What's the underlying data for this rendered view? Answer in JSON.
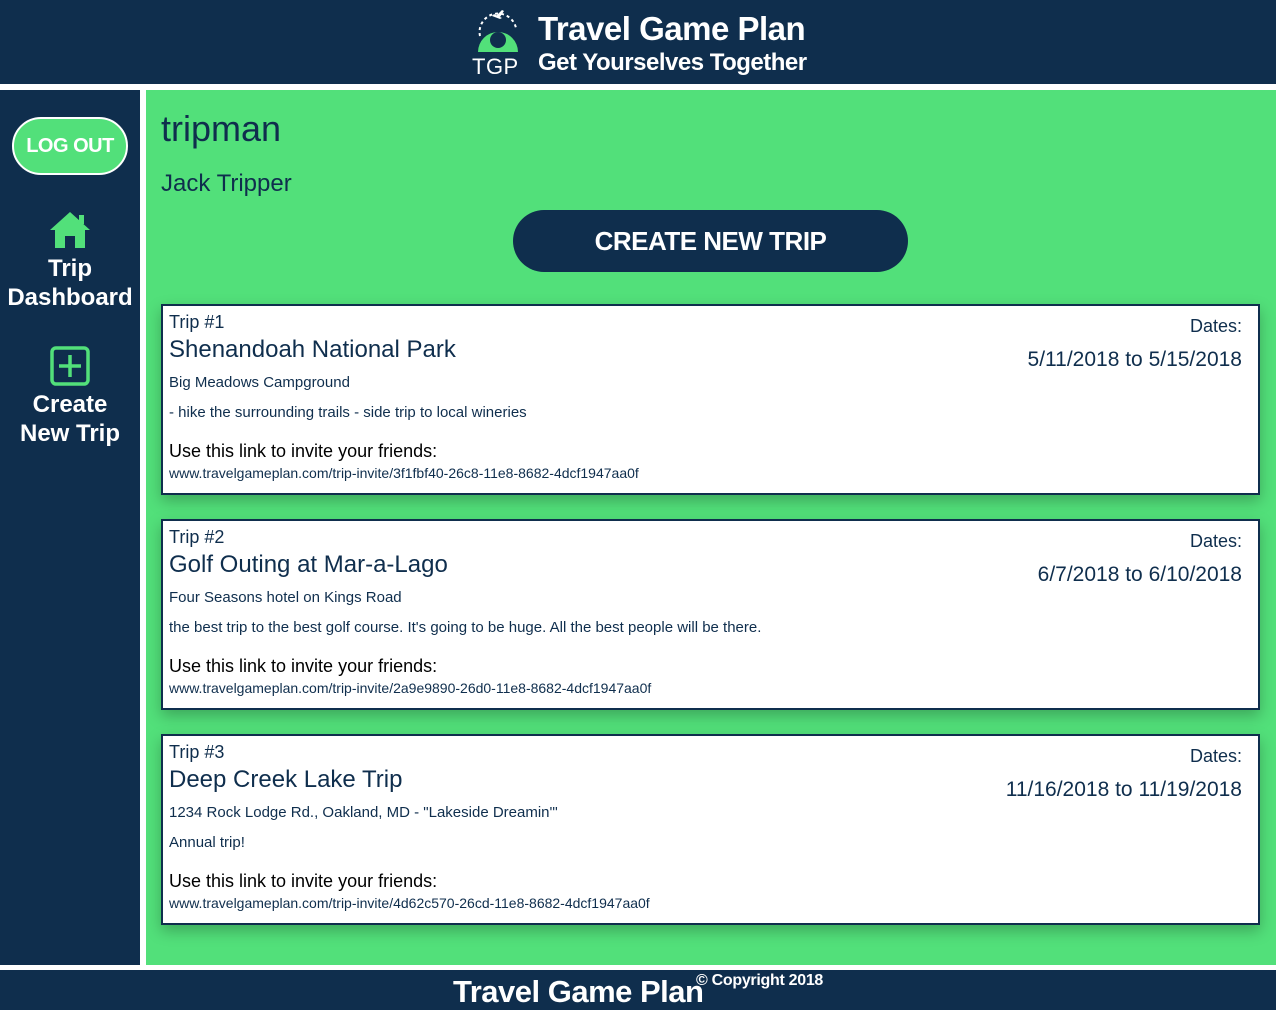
{
  "header": {
    "logo_text": "TGP",
    "title": "Travel Game Plan",
    "subtitle": "Get Yourselves Together"
  },
  "sidebar": {
    "logout_label": "LOG OUT",
    "items": [
      {
        "label_line1": "Trip",
        "label_line2": "Dashboard",
        "icon": "home-icon"
      },
      {
        "label_line1": "Create",
        "label_line2": "New Trip",
        "icon": "plus-square-icon"
      }
    ]
  },
  "main": {
    "username": "tripman",
    "full_name": "Jack Tripper",
    "create_button_label": "CREATE NEW TRIP",
    "trips": [
      {
        "number_label": "Trip #1",
        "name": "Shenandoah National Park",
        "location": "Big Meadows Campground",
        "description": "- hike the surrounding trails - side trip to local wineries",
        "invite_label": "Use this link to invite your friends:",
        "invite_link": "www.travelgameplan.com/trip-invite/3f1fbf40-26c8-11e8-8682-4dcf1947aa0f",
        "dates_label": "Dates:",
        "dates": "5/11/2018 to 5/15/2018"
      },
      {
        "number_label": "Trip #2",
        "name": "Golf Outing at Mar-a-Lago",
        "location": "Four Seasons hotel on Kings Road",
        "description": "the best trip to the best golf course. It's going to be huge. All the best people will be there.",
        "invite_label": "Use this link to invite your friends:",
        "invite_link": "www.travelgameplan.com/trip-invite/2a9e9890-26d0-11e8-8682-4dcf1947aa0f",
        "dates_label": "Dates:",
        "dates": "6/7/2018 to 6/10/2018"
      },
      {
        "number_label": "Trip #3",
        "name": "Deep Creek Lake Trip",
        "location": "1234 Rock Lodge Rd., Oakland, MD - \"Lakeside Dreamin'\"",
        "description": "Annual trip!",
        "invite_label": "Use this link to invite your friends:",
        "invite_link": "www.travelgameplan.com/trip-invite/4d62c570-26cd-11e8-8682-4dcf1947aa0f",
        "dates_label": "Dates:",
        "dates": "11/16/2018 to 11/19/2018"
      }
    ]
  },
  "footer": {
    "brand": "Travel Game Plan",
    "copyright": "© Copyright 2018"
  },
  "colors": {
    "navy": "#0f2e4d",
    "green": "#52e07a",
    "white": "#ffffff"
  }
}
